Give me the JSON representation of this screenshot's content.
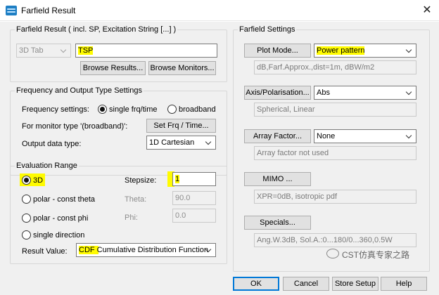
{
  "window": {
    "title": "Farfield Result",
    "close_label": "✕"
  },
  "farfield_result": {
    "group_title": "Farfield Result ( incl. SP, Excitation String [...] )",
    "tab_select": "3D Tab",
    "name_value": "TSP",
    "browse_results_label": "Browse Results...",
    "browse_monitors_label": "Browse Monitors..."
  },
  "frequency": {
    "group_title": "Frequency and Output Type Settings",
    "settings_label": "Frequency settings:",
    "single_label": "single frq/time",
    "broadband_label": "broadband",
    "monitor_label": "For monitor type '(broadband)':",
    "set_frq_label": "Set Frq / Time...",
    "output_label": "Output data type:",
    "output_value": "1D Cartesian"
  },
  "evaluation": {
    "group_title": "Evaluation Range",
    "opt_3d": "3D",
    "opt_polar_theta": "polar - const theta",
    "opt_polar_phi": "polar - const phi",
    "opt_single": "single direction",
    "stepsize_label": "Stepsize:",
    "stepsize_value": "1",
    "theta_label": "Theta:",
    "theta_value": "90.0",
    "phi_label": "Phi:",
    "phi_value": "0.0",
    "result_label": "Result Value:",
    "result_value": "CDF Cumulative Distribution Function"
  },
  "farfield_settings": {
    "group_title": "Farfield Settings",
    "plot_mode_label": "Plot Mode...",
    "plot_mode_value": "Power pattern",
    "plot_mode_info": "dB,Farf.Approx.,dist=1m, dBW/m2",
    "axis_label": "Axis/Polarisation...",
    "axis_value": "Abs",
    "axis_info": "Spherical, Linear",
    "array_label": "Array Factor...",
    "array_value": "None",
    "array_info": "Array factor not used",
    "mimo_label": "MIMO ...",
    "mimo_info": "XPR=0dB, isotropic pdf",
    "specials_label": "Specials...",
    "specials_info": "Ang.W.3dB, Sol.A.:0...180/0...360,0.5W"
  },
  "footer": {
    "ok_label": "OK",
    "cancel_label": "Cancel",
    "store_label": "Store Setup",
    "help_label": "Help",
    "watermark": "CST仿真专家之路"
  },
  "colors": {
    "highlight": "#fffb00",
    "accent": "#0078d7"
  }
}
